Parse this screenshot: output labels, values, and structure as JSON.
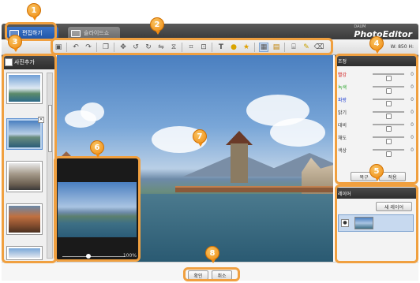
{
  "tabs": {
    "edit_label": "편집하기",
    "slide_label": "슬라이드쇼"
  },
  "logo": {
    "sub": "DAUM",
    "name": "PhotoEditor"
  },
  "toolbar": {
    "size_readout": "W: 850  H:",
    "tools": [
      "image-icon",
      "undo-icon",
      "redo-icon",
      "layers-icon",
      "move-icon",
      "rotate-left-icon",
      "rotate-right-icon",
      "flip-horizontal-icon",
      "flip-vertical-icon",
      "crop-icon",
      "resize-icon",
      "text-icon",
      "speech-bubble-icon",
      "star-icon",
      "frame-icon",
      "picture-icon",
      "border-icon",
      "pencil-icon",
      "eraser-icon"
    ]
  },
  "left_panel": {
    "title": "사진추가",
    "thumb_close": "×"
  },
  "preview": {
    "zoom": "100%"
  },
  "right_panel": {
    "adjust_title": "조정",
    "rows": [
      {
        "label": "빨강",
        "value": "0",
        "color": "#d02020"
      },
      {
        "label": "녹색",
        "value": "0",
        "color": "#20a020"
      },
      {
        "label": "파랑",
        "value": "0",
        "color": "#2040d0"
      },
      {
        "label": "밝기",
        "value": "0",
        "color": "#555555"
      },
      {
        "label": "대비",
        "value": "0",
        "color": "#555555"
      },
      {
        "label": "채도",
        "value": "0",
        "color": "#555555"
      },
      {
        "label": "색상",
        "value": "0",
        "color": "#555555"
      }
    ],
    "restore_label": "복구",
    "apply_label": "적용",
    "layers_title": "레이어",
    "new_layer_label": "새 레이어",
    "layer_eye": "●"
  },
  "bottom": {
    "confirm_label": "확인",
    "cancel_label": "취소"
  },
  "callouts": [
    "1",
    "2",
    "3",
    "4",
    "5",
    "6",
    "7",
    "8"
  ],
  "accent_color": "#f0a040"
}
